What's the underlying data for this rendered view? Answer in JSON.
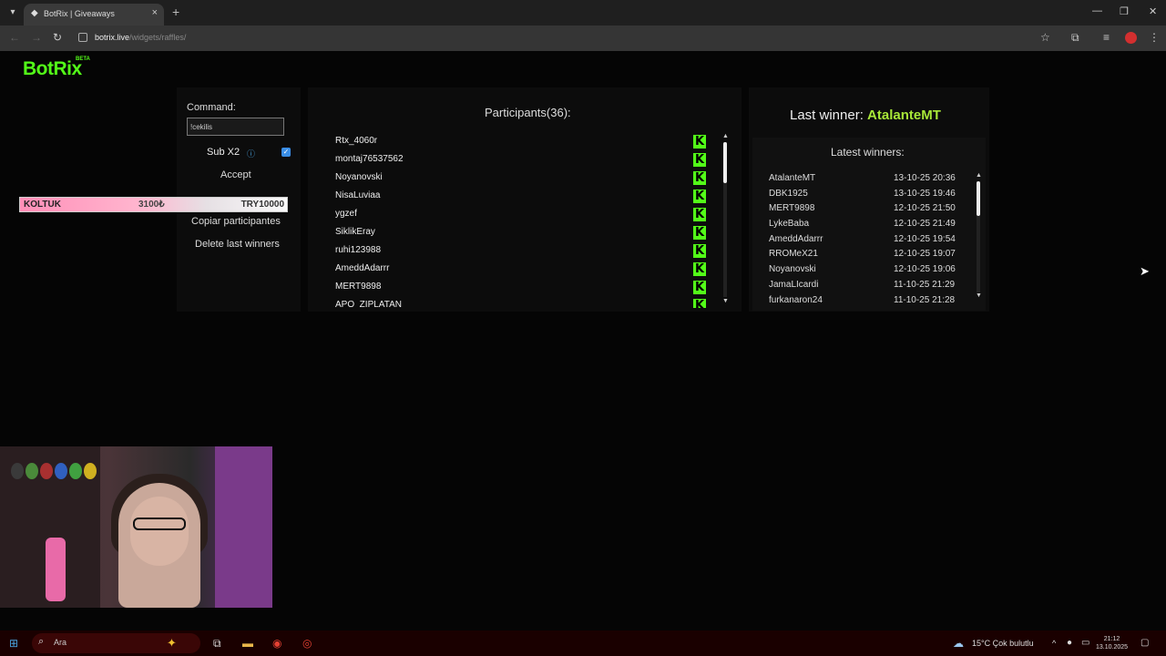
{
  "browser": {
    "tab_title": "BotRix | Giveaways",
    "url_host": "botrix.live",
    "url_path": "/widgets/raffles/",
    "new_tab_label": "+"
  },
  "app": {
    "logo": "BotRix",
    "logo_badge": "BETA"
  },
  "controls": {
    "command_label": "Command:",
    "command_value": "!cekilis",
    "sub_label": "Sub X2",
    "sub_checked": true,
    "accept_label": "Accept",
    "copy_label": "Copiar participantes",
    "delete_label": "Delete last winners"
  },
  "overlay": {
    "name": "KOLTUK",
    "amount": "3100₺",
    "goal": "TRY10000"
  },
  "participants": {
    "title": "Participants(36):",
    "items": [
      "Rtx_4060r",
      "montaj76537562",
      "Noyanovski",
      "NisaLuviaa",
      "ygzef",
      "SiklikEray",
      "ruhi123988",
      "AmeddAdarrr",
      "MERT9898",
      "APO_ZIPLATAN"
    ]
  },
  "winners": {
    "last_winner_label": "Last winner:",
    "last_winner_name": "AtalanteMT",
    "latest_title": "Latest winners:",
    "items": [
      {
        "name": "AtalanteMT",
        "time": "13-10-25 20:36"
      },
      {
        "name": "DBK1925",
        "time": "13-10-25 19:46"
      },
      {
        "name": "MERT9898",
        "time": "12-10-25 21:50"
      },
      {
        "name": "LykeBaba",
        "time": "12-10-25 21:49"
      },
      {
        "name": "AmeddAdarrr",
        "time": "12-10-25 19:54"
      },
      {
        "name": "RROMeX21",
        "time": "12-10-25 19:07"
      },
      {
        "name": "Noyanovski",
        "time": "12-10-25 19:06"
      },
      {
        "name": "JamaLIcardi",
        "time": "11-10-25 21:29"
      },
      {
        "name": "furkanaron24",
        "time": "11-10-25 21:28"
      }
    ]
  },
  "taskbar": {
    "search_placeholder": "Ara",
    "weather": "15°C  Çok bulutlu",
    "time": "21:12",
    "date": "13.10.2025"
  },
  "colors": {
    "kick_green": "#53fc18",
    "winner_green": "#a8e838",
    "taskbar_bg": "#1a0000"
  }
}
